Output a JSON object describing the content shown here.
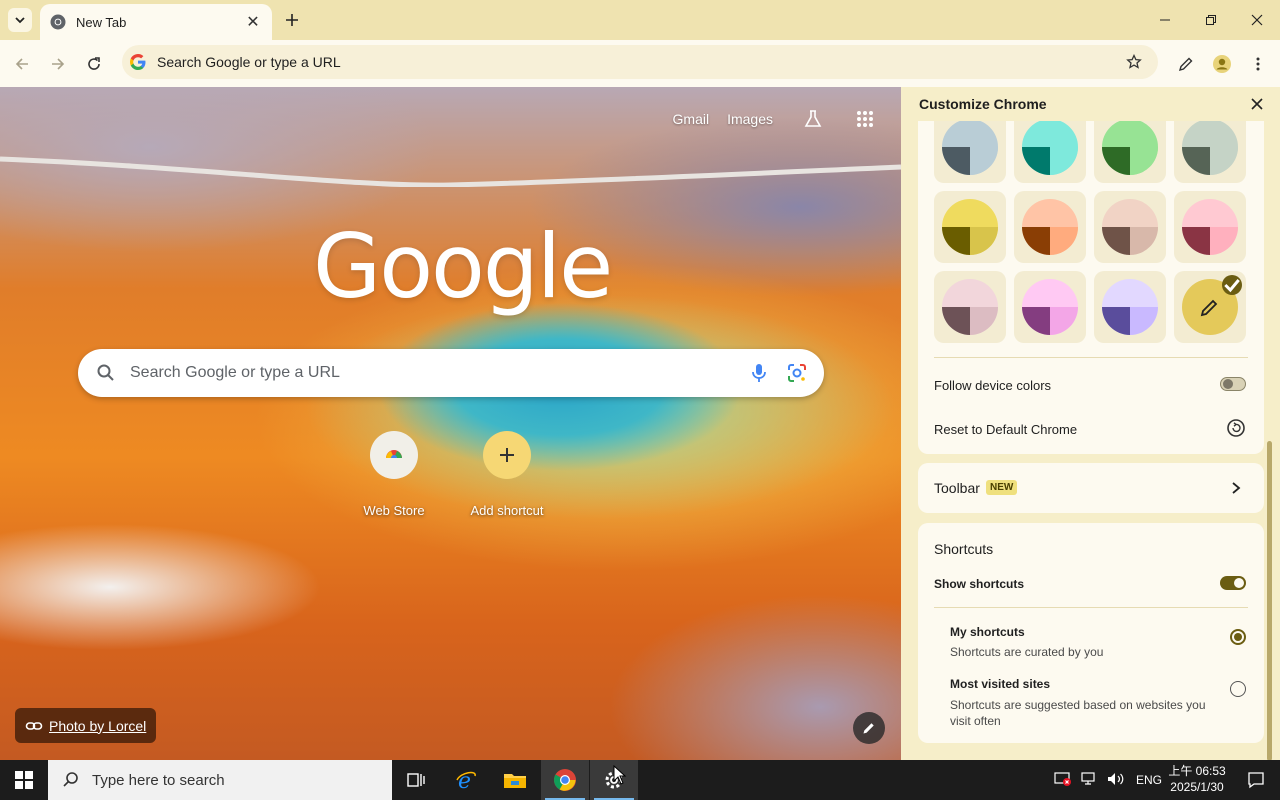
{
  "window": {
    "tab_title": "New Tab"
  },
  "toolbar": {
    "omnibox_placeholder": "Search Google or type a URL"
  },
  "ntp": {
    "links": [
      "Gmail",
      "Images"
    ],
    "logo": "Google",
    "search_placeholder": "Search Google or type a URL",
    "shortcuts": [
      {
        "label": "Web Store"
      },
      {
        "label": "Add shortcut"
      }
    ],
    "attribution": "Photo by Lorcel"
  },
  "panel": {
    "title": "Customize Chrome",
    "colors": {
      "swatches": [
        {
          "name": "grey-blue",
          "top": "#b9cdd6",
          "left": "#4d5b63",
          "right": "#b9cdd6",
          "selected": false
        },
        {
          "name": "aqua",
          "top": "#7ee9dc",
          "left": "#007a6c",
          "right": "#7ee9dc",
          "selected": false
        },
        {
          "name": "green",
          "top": "#97e394",
          "left": "#2e6b26",
          "right": "#97e394",
          "selected": false
        },
        {
          "name": "viridian",
          "top": "#c5d3c6",
          "left": "#566456",
          "right": "#c5d3c6",
          "selected": false
        },
        {
          "name": "citron",
          "top": "#efdb5e",
          "left": "#6a5d00",
          "right": "#d8c44b",
          "selected": false
        },
        {
          "name": "apricot",
          "top": "#ffc4a6",
          "left": "#8a3e05",
          "right": "#ffab7e",
          "selected": false
        },
        {
          "name": "rose-brown",
          "top": "#f1d3c5",
          "left": "#6f5348",
          "right": "#d8b8aa",
          "selected": false
        },
        {
          "name": "pink",
          "top": "#ffc9d2",
          "left": "#8a3444",
          "right": "#ffb0be",
          "selected": false
        },
        {
          "name": "mauve",
          "top": "#f2d6db",
          "left": "#6d5257",
          "right": "#dcbcc2",
          "selected": false
        },
        {
          "name": "fuchsia",
          "top": "#ffc9f3",
          "left": "#843d80",
          "right": "#f3a6e7",
          "selected": false
        },
        {
          "name": "violet",
          "top": "#e2d8ff",
          "left": "#5a4d9c",
          "right": "#c9b9ff",
          "selected": false
        },
        {
          "name": "custom",
          "top": "#e4c95a",
          "left": "#e4c95a",
          "right": "#e4c95a",
          "selected": true
        }
      ]
    },
    "follow_device_colors": {
      "label": "Follow device colors",
      "on": false
    },
    "reset": {
      "label": "Reset to Default Chrome"
    },
    "toolbar_row": {
      "label": "Toolbar",
      "badge": "NEW"
    },
    "shortcuts": {
      "title": "Shortcuts",
      "show_label": "Show shortcuts",
      "show_on": true,
      "options": [
        {
          "title": "My shortcuts",
          "desc": "Shortcuts are curated by you",
          "selected": true
        },
        {
          "title": "Most visited sites",
          "desc": "Shortcuts are suggested based on websites you visit often",
          "selected": false
        }
      ]
    }
  },
  "taskbar": {
    "search_placeholder": "Type here to search",
    "ime": "ENG",
    "time": "上午 06:53",
    "date": "2025/1/30"
  },
  "colors": {
    "frame": "#efe3b0",
    "toolbar": "#fdfaf0",
    "accent": "#6b5d12",
    "shortcut_add": "#f6d774"
  }
}
